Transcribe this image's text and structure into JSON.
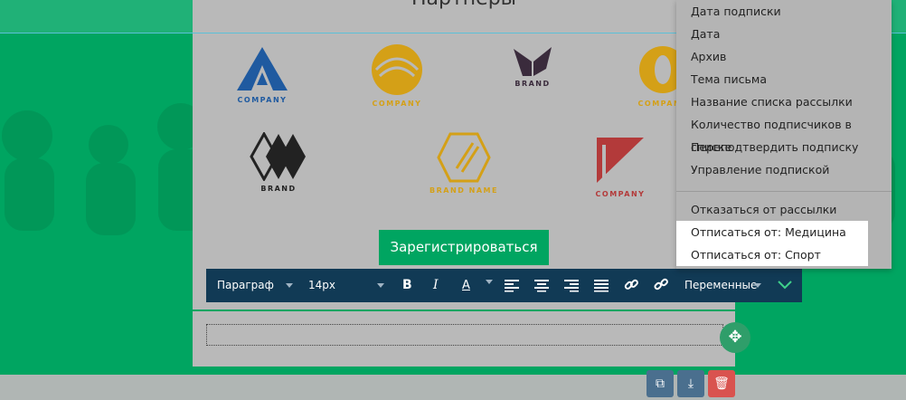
{
  "partners": {
    "title": "Партнеры",
    "logos": [
      {
        "name": "COMPANY",
        "color": "#1f5aa0"
      },
      {
        "name": "COMPANY",
        "color": "#d4a017"
      },
      {
        "name": "BRAND",
        "color": "#3a2b3c"
      },
      {
        "name": "COMPANY",
        "color": "#d4a017"
      },
      {
        "name": "BRAND",
        "color": "#222222"
      },
      {
        "name": "BRAND NAME",
        "color": "#d4a017"
      },
      {
        "name": "COMPANY",
        "color": "#b33a3a"
      }
    ]
  },
  "register_button": "Зарегистрироваться",
  "toolbar": {
    "paragraph": "Параграф",
    "font_size": "14px",
    "bold": "B",
    "italic": "I",
    "text_color": "A",
    "variables": "Переменные"
  },
  "dropdown": {
    "items": [
      "Дата подписки",
      "Дата",
      "Архив",
      "Тема письма",
      "Название списка рассылки",
      "Количество подписчиков в списке",
      "Переподтвердить подписку",
      "Управление подпиской",
      "Отказаться от рассылки",
      "Отписаться от: Медицина",
      "Отписаться от: Спорт"
    ]
  },
  "colors": {
    "brand_green": "#00a561",
    "toolbar_bg": "#113a55",
    "delete_red": "#d9534f",
    "action_blue": "#4a6f8e"
  }
}
